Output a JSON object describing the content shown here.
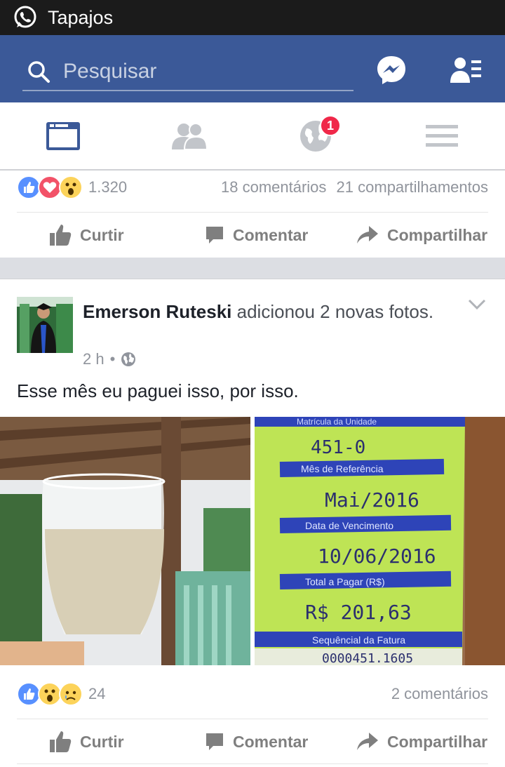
{
  "status_bar": {
    "app_title": "Tapajos",
    "app_icon": "whatsapp-icon"
  },
  "header": {
    "search_placeholder": "Pesquisar",
    "icons": [
      "search-icon",
      "messenger-icon",
      "friend-requests-icon"
    ],
    "brand_color": "#3b5998"
  },
  "tabs": {
    "items": [
      "news-feed-icon",
      "friends-icon",
      "notifications-globe-icon",
      "menu-icon"
    ],
    "notification_badge": "1",
    "active_color": "#3b5998",
    "inactive_color": "#c2c5ca"
  },
  "post1": {
    "reaction_count": "1.320",
    "comments": "18 comentários",
    "shares": "21 compartilhamentos"
  },
  "post2": {
    "author": "Emerson Ruteski",
    "action_text": " adicionou 2 novas fotos.",
    "time": "2 h",
    "meta_separator": "•",
    "text": "Esse mês eu paguei isso, por isso.",
    "reaction_count": "24",
    "comments": "2 comentários",
    "bill": {
      "matricula_label": "Matrícula da Unidade",
      "matricula": "451-0",
      "ref_label": "Mês de Referência",
      "ref": "Mai/2016",
      "due_label": "Data de Vencimento",
      "due": "10/06/2016",
      "total_label": "Total a Pagar (R$)",
      "total": "R$   201,63",
      "seq_label": "Sequêncial da Fatura",
      "seq": "0000451.1605"
    }
  },
  "actions": {
    "like": "Curtir",
    "comment": "Comentar",
    "share": "Compartilhar"
  }
}
